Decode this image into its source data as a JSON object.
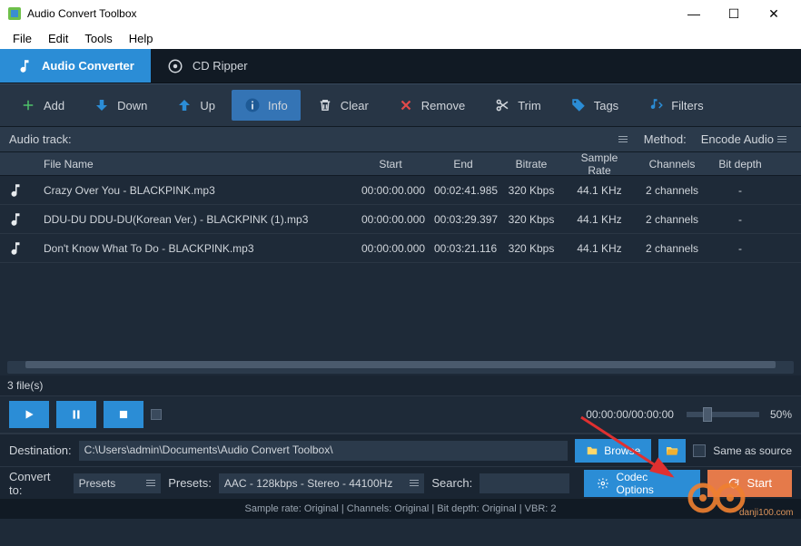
{
  "window": {
    "title": "Audio Convert Toolbox",
    "minimize": "—",
    "maximize": "☐",
    "close": "✕"
  },
  "menu": [
    "File",
    "Edit",
    "Tools",
    "Help"
  ],
  "tabs": {
    "audio_converter": "Audio Converter",
    "cd_ripper": "CD Ripper"
  },
  "toolbar": {
    "add": "Add",
    "down": "Down",
    "up": "Up",
    "info": "Info",
    "clear": "Clear",
    "remove": "Remove",
    "trim": "Trim",
    "tags": "Tags",
    "filters": "Filters"
  },
  "track": {
    "label": "Audio track:",
    "method_label": "Method:",
    "method_value": "Encode Audio"
  },
  "columns": {
    "file_name": "File Name",
    "start": "Start",
    "end": "End",
    "bitrate": "Bitrate",
    "sample_rate": "Sample Rate",
    "channels": "Channels",
    "bit_depth": "Bit depth"
  },
  "rows": [
    {
      "name": "Crazy Over You - BLACKPINK.mp3",
      "start": "00:00:00.000",
      "end": "00:02:41.985",
      "bitrate": "320 Kbps",
      "sample": "44.1 KHz",
      "channels": "2 channels",
      "depth": "-"
    },
    {
      "name": "DDU-DU DDU-DU(Korean Ver.) - BLACKPINK (1).mp3",
      "start": "00:00:00.000",
      "end": "00:03:29.397",
      "bitrate": "320 Kbps",
      "sample": "44.1 KHz",
      "channels": "2 channels",
      "depth": "-"
    },
    {
      "name": "Don't Know What To Do - BLACKPINK.mp3",
      "start": "00:00:00.000",
      "end": "00:03:21.116",
      "bitrate": "320 Kbps",
      "sample": "44.1 KHz",
      "channels": "2 channels",
      "depth": "-"
    }
  ],
  "file_count": "3 file(s)",
  "playback": {
    "time": "00:00:00/00:00:00",
    "volume_pct": "50%"
  },
  "destination": {
    "label": "Destination:",
    "path": "C:\\Users\\admin\\Documents\\Audio Convert Toolbox\\",
    "browse": "Browse",
    "same_as_source": "Same as source"
  },
  "convert": {
    "label": "Convert to:",
    "presets_label": "Presets",
    "presets_caption": "Presets:",
    "preset_value": "AAC - 128kbps - Stereo - 44100Hz",
    "search_label": "Search:",
    "codec_options": "Codec Options",
    "start": "Start"
  },
  "status": "Sample rate: Original | Channels: Original | Bit depth: Original | VBR: 2",
  "watermark": "danji100.com"
}
